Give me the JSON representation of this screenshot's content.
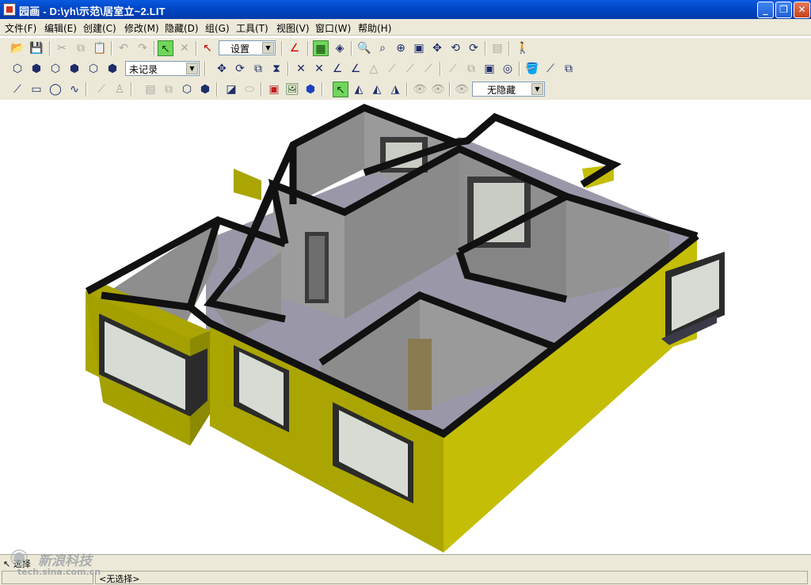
{
  "window": {
    "title": "园画 - D:\\yh\\示范\\居室立~2.LIT",
    "controls": {
      "minimize": "_",
      "restore": "❐",
      "close": "✕"
    }
  },
  "menu": {
    "items": [
      "文件(F)",
      "编辑(E)",
      "创建(C)",
      "修改(M)",
      "隐藏(D)",
      "组(G)",
      "工具(T)",
      "视图(V)",
      "窗口(W)",
      "帮助(H)"
    ]
  },
  "toolbar1": {
    "view_mode_select": "设置"
  },
  "toolbar2": {
    "record_select": "未记录"
  },
  "toolbar3": {
    "hide_select": "无隐藏"
  },
  "status": {
    "command_label": "选择",
    "selection_text": "<无选择>"
  },
  "watermark": {
    "brand_text": "新浪科技",
    "url_text": "tech.sina.com.cn"
  },
  "colors": {
    "exterior_wall": "#a9a400",
    "wall_top": "#101010",
    "interior_wall": "#8e8e8e",
    "floor": "#9a98a8",
    "window_frame": "#2b2b2b",
    "window_glass": "#d6dbd4"
  }
}
